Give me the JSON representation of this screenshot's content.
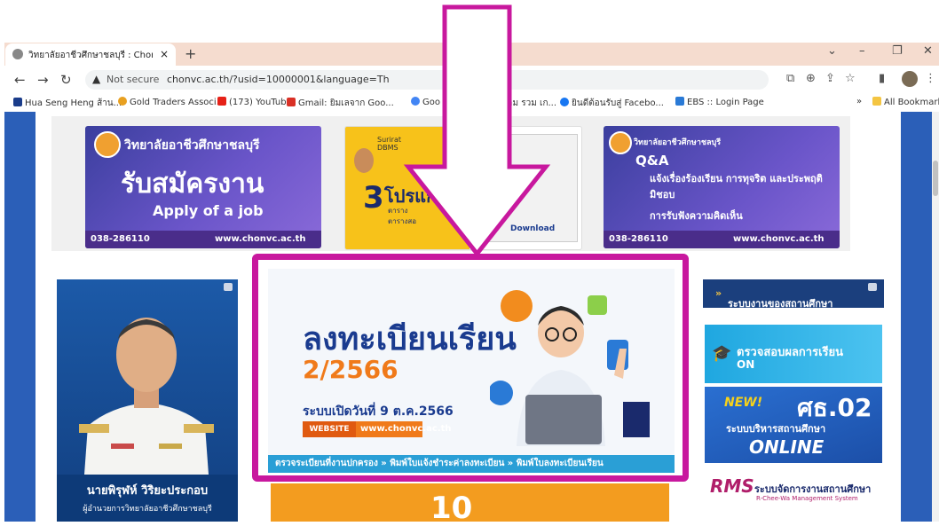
{
  "browser": {
    "tab_title": "วิทยาลัยอาชีวศึกษาชลบุรี : Chonvc :",
    "tab_close": "×",
    "new_tab": "+",
    "not_secure": "Not secure",
    "url": "chonvc.ac.th/?usid=10000001&language=Th",
    "bookmarks": [
      "Hua Seng Heng ส้าน...",
      "Gold Traders Associ...",
      "(173) YouTube",
      "Gmail: ยิมเลจาก Goo...",
      "Goo",
      "ตอม รวม เก...",
      "ยินดีต้อนรับสู่ Facebo...",
      "EBS :: Login Page"
    ],
    "more_bookmarks": "»",
    "all_bookmarks": "All Bookmarks"
  },
  "banners": {
    "apply": {
      "school": "วิทยาลัยอาชีวศึกษาชลบุรี",
      "heading": "รับสมัครงาน",
      "sub": "Apply of a job",
      "phone": "038-286110",
      "web": "www.chonvc.ac.th"
    },
    "program": {
      "brand": "Surirat DBMS",
      "number": "3",
      "heading": "โปรแกร",
      "line1": "ตาราง",
      "line2": "ตารางสอ",
      "download": "Download"
    },
    "qa": {
      "school": "วิทยาลัยอาชีวศึกษาชลบุรี",
      "item1": "Q&A",
      "item2": "แจ้งเรื่องร้องเรียน การทุจริต และประพฤติมิชอบ",
      "item3": "การรับฟังความคิดเห็น",
      "phone": "038-286110",
      "web": "www.chonvc.ac.th"
    }
  },
  "director": {
    "name": "นายพิรุฬห์ วิริยะประกอบ",
    "title": "ผู้อำนวยการวิทยาลัยอาชีวศึกษาชลบุรี"
  },
  "registration": {
    "title": "ลงทะเบียนเรียน",
    "term": "2/2566",
    "open": "ระบบเปิดวันที่ 9 ต.ค.2566",
    "web_label": "WEBSITE",
    "web_url": "www.chonvc.ac.th",
    "strip": "ตรวจระเบียนที่งานปกครอง » พิมพ์ใบแจ้งชำระค่าลงทะเบียน » พิมพ์ใบลงทะเบียนเรียน"
  },
  "bottom_banner_text": "10",
  "sidebar": {
    "header": "ระบบงานของสถานศึกษา",
    "header_arrow": "»",
    "grade_title": "ตรวจสอบผลการเรียน",
    "grade_sub": "ON",
    "ts_new": "NEW!",
    "ts_code": "ศธ.02",
    "ts_desc": "ระบบบริหารสถานศึกษา",
    "ts_online": "ONLINE",
    "rms_logo": "RMS",
    "rms_title": "ระบบจัดการงานสถานศึกษา",
    "rms_sub": "R-Chee-Wa Management System"
  },
  "colors": {
    "highlight": "#c8189e",
    "page_bg": "#2b5fb8",
    "tab_strip": "#f5dccf"
  }
}
